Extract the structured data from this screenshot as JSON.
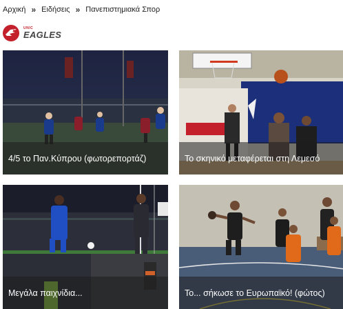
{
  "breadcrumb": {
    "items": [
      "Αρχική",
      "Ειδήσεις",
      "Πανεπιστημιακά Σπορ"
    ],
    "separator": "»"
  },
  "logo": {
    "sub": "UNIC",
    "name": "EAGLES",
    "brand_color": "#c3202b"
  },
  "cards": [
    {
      "title": "4/5 το Παν.Κύπρου (φωτορεπορτάζ)",
      "image_icon": "football-photo"
    },
    {
      "title": "Το σκηνικό μεταφέρεται στη Λεμεσό",
      "image_icon": "basketball-photo"
    },
    {
      "title": "Μεγάλα παιχνίδια...",
      "image_icon": "football-photo"
    },
    {
      "title": "Το... σήκωσε το Ευρωπαϊκό! (φώτος)",
      "image_icon": "handball-photo"
    }
  ]
}
